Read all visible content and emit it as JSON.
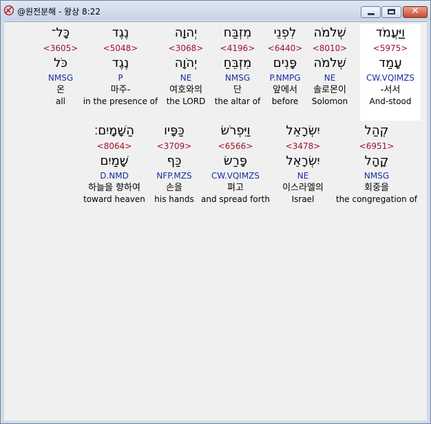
{
  "window": {
    "title": "@원전분해 - 왕상 8:22"
  },
  "colors": {
    "strong_number": "#a0102a",
    "grammar_code": "#1a2ea0"
  },
  "row1": [
    {
      "hebrew": "וַיַּעֲמֹד",
      "strong": "<5975>",
      "lemma": "עָמַד",
      "grammar": "CW.VQIMZS",
      "korean": "-서서",
      "english": "And-stood"
    },
    {
      "hebrew": "שְׁלֹמֹה",
      "strong": "<8010>",
      "lemma": "שְׁלֹמֹה",
      "grammar": "NE",
      "korean": "솔로몬이",
      "english": "Solomon"
    },
    {
      "hebrew": "לִפְנֵי",
      "strong": "<6440>",
      "lemma": "פָּנִים",
      "grammar": "P.NMPG",
      "korean": "앞에서",
      "english": "before"
    },
    {
      "hebrew": "מִזְבַּח",
      "strong": "<4196>",
      "lemma": "מִזְבֵּחַ",
      "grammar": "NMSG",
      "korean": "단",
      "english": "the altar of"
    },
    {
      "hebrew": "יְהוָה",
      "strong": "<3068>",
      "lemma": "יְהֹוָה",
      "grammar": "NE",
      "korean": "여호와의",
      "english": "the LORD"
    },
    {
      "hebrew": "נֶגֶד",
      "strong": "<5048>",
      "lemma": "נֶגֶד",
      "grammar": "P",
      "korean": "마주-",
      "english": "in the presence of"
    },
    {
      "hebrew": "כָּל־",
      "strong": "<3605>",
      "lemma": "כֹּל",
      "grammar": "NMSG",
      "korean": "온",
      "english": "all"
    }
  ],
  "row2": [
    {
      "hebrew": "קְהַל",
      "strong": "<6951>",
      "lemma": "קָהָל",
      "grammar": "NMSG",
      "korean": "회중을",
      "english": "the congregation of"
    },
    {
      "hebrew": "יִשְׂרָאֵל",
      "strong": "<3478>",
      "lemma": "יִשְׂרָאֵל",
      "grammar": "NE",
      "korean": "이스라엘의",
      "english": "Israel"
    },
    {
      "hebrew": "וַיִּפְרֹשׂ",
      "strong": "<6566>",
      "lemma": "פָּרַשׂ",
      "grammar": "CW.VQIMZS",
      "korean": "펴고",
      "english": "and spread forth"
    },
    {
      "hebrew": "כַּפָּיו",
      "strong": "<3709>",
      "lemma": "כַּף",
      "grammar": "NFP.MZS",
      "korean": "손을",
      "english": "his hands"
    },
    {
      "hebrew": "הַשָּׁמָיִם׃",
      "strong": "<8064>",
      "lemma": "שָׁמַיִם",
      "grammar": "D.NMD",
      "korean": "하늘을 향하여",
      "english": "toward heaven"
    }
  ]
}
